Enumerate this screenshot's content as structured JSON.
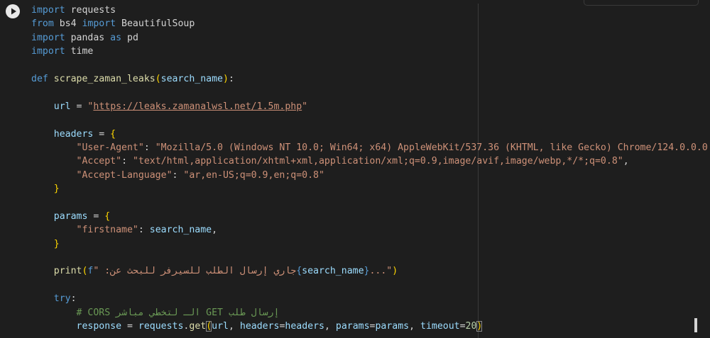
{
  "cell": {
    "run_button_label": "Run cell",
    "cursor_label": "Text cursor"
  },
  "code": {
    "l1_kw": "import",
    "l1_mod": " requests",
    "l2_kw1": "from",
    "l2_mod": " bs4 ",
    "l2_kw2": "import",
    "l2_name": " BeautifulSoup",
    "l3_kw1": "import",
    "l3_mod": " pandas ",
    "l3_kw2": "as",
    "l3_alias": " pd",
    "l4_kw": "import",
    "l4_mod": " time",
    "l6_def": "def",
    "l6_fn": "scrape_zaman_leaks",
    "l6_open": "(",
    "l6_param": "search_name",
    "l6_close": ")",
    "l6_colon": ":",
    "l8_var": "url",
    "l8_eq": " = ",
    "l8_q1": "\"",
    "l8_url": "https://leaks.zamanalwsl.net/1.5m.php",
    "l8_q2": "\"",
    "l10_var": "headers",
    "l10_eq": " = ",
    "l10_brace": "{",
    "l11_key": "\"User-Agent\"",
    "l11_colon": ": ",
    "l11_val": "\"Mozilla/5.0 (Windows NT 10.0; Win64; x64) AppleWebKit/537.36 (KHTML, like Gecko) Chrome/124.0.0.0",
    "l12_key": "\"Accept\"",
    "l12_colon": ": ",
    "l12_val": "\"text/html,application/xhtml+xml,application/xml;q=0.9,image/avif,image/webp,*/*;q=0.8\"",
    "l12_comma": ",",
    "l13_key": "\"Accept-Language\"",
    "l13_colon": ": ",
    "l13_val": "\"ar,en-US;q=0.9,en;q=0.8\"",
    "l14_brace": "}",
    "l16_var": "params",
    "l16_eq": " = ",
    "l16_brace": "{",
    "l17_key": "\"firstname\"",
    "l17_colon": ": ",
    "l17_val": "search_name",
    "l17_comma": ",",
    "l18_brace": "}",
    "l20_fn": "print",
    "l20_open": "(",
    "l20_fprefix": "f",
    "l20_q": "\"",
    "l20_ar": "جاري إرسال الطلب للسيرفر للبحث عن: ",
    "l20_b1": "{",
    "l20_interp": "search_name",
    "l20_b2": "}",
    "l20_tail": "...\"",
    "l20_close": ")",
    "l22_kw": "try",
    "l22_colon": ":",
    "l23_hash": "# ",
    "l23_comment": "إرسال طلب GET الـ لتخطي مباشر CORS",
    "l24_var": "response",
    "l24_eq": " = ",
    "l24_obj": "requests",
    "l24_dot": ".",
    "l24_fn": "get",
    "l24_open": "(",
    "l24_a1": "url",
    "l24_c1": ", ",
    "l24_k1": "headers",
    "l24_e1": "=",
    "l24_v1": "headers",
    "l24_c2": ", ",
    "l24_k2": "params",
    "l24_e2": "=",
    "l24_v2": "params",
    "l24_c3": ", ",
    "l24_k3": "timeout",
    "l24_e3": "=",
    "l24_num": "20",
    "l24_close": ")"
  },
  "colors": {
    "background": "#1e1e1e",
    "keyword": "#569cd6",
    "function": "#dcdcaa",
    "string": "#ce9178",
    "variable": "#9cdcfe",
    "number": "#b5cea8",
    "comment": "#6a9955",
    "bracket_level1": "#ffd700",
    "bracket_level2": "#da70d6"
  },
  "icons": {
    "run": "play-circle-icon"
  }
}
